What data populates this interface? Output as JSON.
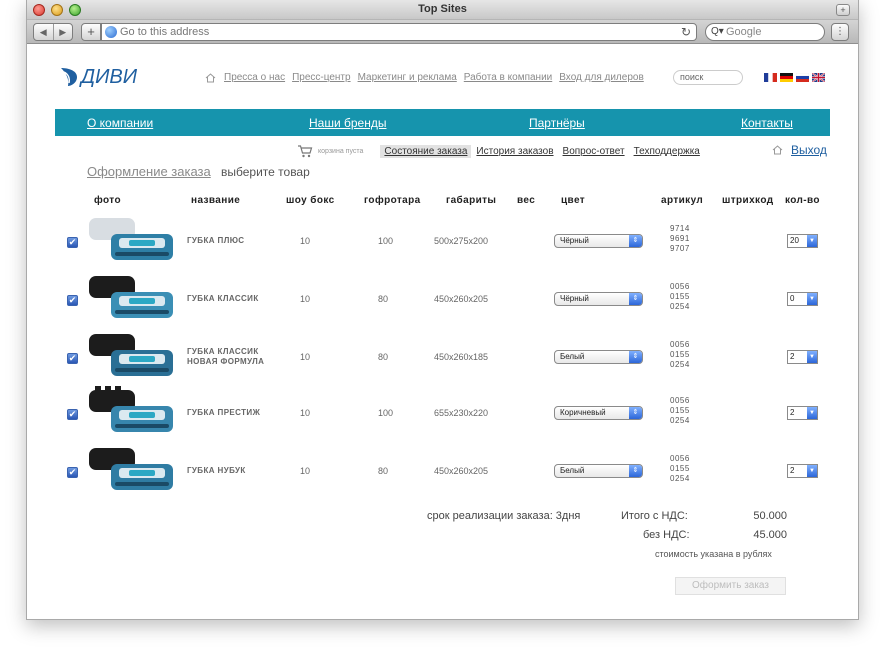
{
  "window": {
    "title": "Top Sites"
  },
  "toolbar": {
    "address_placeholder": "Go to this address",
    "search_placeholder": "Google"
  },
  "site": {
    "logo_text": "ДИВИ",
    "top_links": [
      "Пресса о нас",
      "Пресс-центр",
      "Маркетинг и реклама",
      "Работа в компании",
      "Вход для дилеров"
    ],
    "search_placeholder": "поиск",
    "flags": [
      "fr",
      "de",
      "ru",
      "gb"
    ],
    "main_nav": [
      "О компании",
      "Наши бренды",
      "Партнёры",
      "Контакты"
    ],
    "cart_text": "корзина пуста",
    "sub_tabs": [
      "Состояние заказа",
      "История заказов",
      "Вопрос-ответ",
      "Техподдержка"
    ],
    "exit_label": "Выход",
    "accent": "#1694ad"
  },
  "order": {
    "title": "Оформление заказа",
    "subtitle": "выберите товар",
    "columns": [
      "фото",
      "название",
      "шоу бокс",
      "гофротара",
      "габариты",
      "вес",
      "цвет",
      "артикул",
      "штрихкод",
      "кол-во"
    ],
    "rows": [
      {
        "checked": true,
        "name1": "ГУБКА ПЛЮС",
        "name2": "",
        "showbox": "10",
        "box": "100",
        "dims": "500x275x200",
        "color": "Чёрный",
        "art": [
          "9714",
          "9691",
          "9707"
        ],
        "qty": "20"
      },
      {
        "checked": true,
        "name1": "ГУБКА КЛАССИК",
        "name2": "",
        "showbox": "10",
        "box": "80",
        "dims": "450x260x205",
        "color": "Чёрный",
        "art": [
          "0056",
          "0155",
          "0254"
        ],
        "qty": "0"
      },
      {
        "checked": true,
        "name1": "ГУБКА КЛАССИК",
        "name2": "НОВАЯ ФОРМУЛА",
        "showbox": "10",
        "box": "80",
        "dims": "450x260x185",
        "color": "Белый",
        "art": [
          "0056",
          "0155",
          "0254"
        ],
        "qty": "2"
      },
      {
        "checked": true,
        "name1": "ГУБКА ПРЕСТИЖ",
        "name2": "",
        "showbox": "10",
        "box": "100",
        "dims": "655x230x220",
        "color": "Коричневый",
        "art": [
          "0056",
          "0155",
          "0254"
        ],
        "qty": "2"
      },
      {
        "checked": true,
        "name1": "ГУБКА НУБУК",
        "name2": "",
        "showbox": "10",
        "box": "80",
        "dims": "450x260x205",
        "color": "Белый",
        "art": [
          "0056",
          "0155",
          "0254"
        ],
        "qty": "2"
      }
    ],
    "term_text": "срок реализации заказа: 3дня",
    "total_vat_label": "Итого с НДС:",
    "total_vat_value": "50.000",
    "no_vat_label": "без НДС:",
    "no_vat_value": "45.000",
    "currency_note": "стоимость указана в рублях",
    "submit_label": "Оформить заказ"
  }
}
